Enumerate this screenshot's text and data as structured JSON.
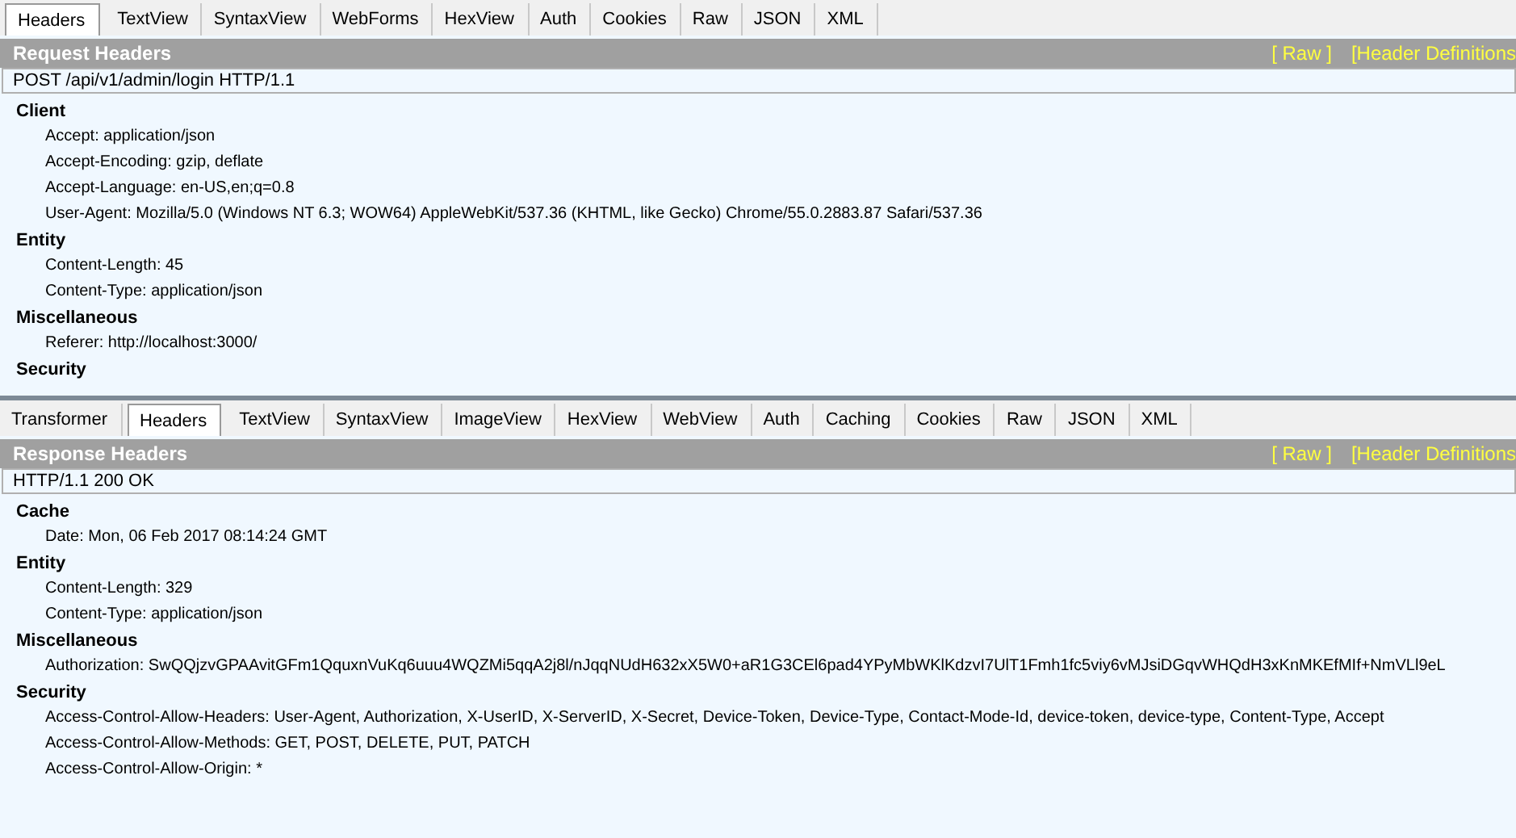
{
  "request": {
    "tabs": [
      {
        "label": "Headers",
        "selected": true
      },
      {
        "label": "TextView",
        "selected": false
      },
      {
        "label": "SyntaxView",
        "selected": false
      },
      {
        "label": "WebForms",
        "selected": false
      },
      {
        "label": "HexView",
        "selected": false
      },
      {
        "label": "Auth",
        "selected": false
      },
      {
        "label": "Cookies",
        "selected": false
      },
      {
        "label": "Raw",
        "selected": false
      },
      {
        "label": "JSON",
        "selected": false
      },
      {
        "label": "XML",
        "selected": false
      }
    ],
    "title": "Request Headers",
    "links": [
      "[ Raw ]",
      "[Header Definitions"
    ],
    "first_line": "POST /api/v1/admin/login HTTP/1.1",
    "groups": [
      {
        "name": "Client",
        "headers": [
          "Accept: application/json",
          "Accept-Encoding: gzip, deflate",
          "Accept-Language: en-US,en;q=0.8",
          "User-Agent: Mozilla/5.0 (Windows NT 6.3; WOW64) AppleWebKit/537.36 (KHTML, like Gecko) Chrome/55.0.2883.87 Safari/537.36"
        ]
      },
      {
        "name": "Entity",
        "headers": [
          "Content-Length: 45",
          "Content-Type: application/json"
        ]
      },
      {
        "name": "Miscellaneous",
        "headers": [
          "Referer: http://localhost:3000/"
        ]
      },
      {
        "name": "Security"
      }
    ]
  },
  "response": {
    "tabs": [
      {
        "label": "Transformer",
        "selected": false
      },
      {
        "label": "Headers",
        "selected": true
      },
      {
        "label": "TextView",
        "selected": false
      },
      {
        "label": "SyntaxView",
        "selected": false
      },
      {
        "label": "ImageView",
        "selected": false
      },
      {
        "label": "HexView",
        "selected": false
      },
      {
        "label": "WebView",
        "selected": false
      },
      {
        "label": "Auth",
        "selected": false
      },
      {
        "label": "Caching",
        "selected": false
      },
      {
        "label": "Cookies",
        "selected": false
      },
      {
        "label": "Raw",
        "selected": false
      },
      {
        "label": "JSON",
        "selected": false
      },
      {
        "label": "XML",
        "selected": false
      }
    ],
    "title": "Response Headers",
    "links": [
      "[ Raw ]",
      "[Header Definitions"
    ],
    "first_line": "HTTP/1.1 200 OK",
    "groups": [
      {
        "name": "Cache",
        "headers": [
          "Date: Mon, 06 Feb 2017 08:14:24 GMT"
        ]
      },
      {
        "name": "Entity",
        "headers": [
          "Content-Length: 329",
          "Content-Type: application/json"
        ]
      },
      {
        "name": "Miscellaneous",
        "headers": [
          "Authorization: SwQQjzvGPAAvitGFm1QquxnVuKq6uuu4WQZMi5qqA2j8l/nJqqNUdH632xX5W0+aR1G3CEl6pad4YPyMbWKlKdzvI7UlT1Fmh1fc5viy6vMJsiDGqvWHQdH3xKnMKEfMIf+NmVLl9eL"
        ]
      },
      {
        "name": "Security",
        "headers": [
          "Access-Control-Allow-Headers: User-Agent, Authorization, X-UserID, X-ServerID, X-Secret, Device-Token, Device-Type, Contact-Mode-Id, device-token, device-type, Content-Type, Accept",
          "Access-Control-Allow-Methods: GET, POST, DELETE, PUT, PATCH",
          "Access-Control-Allow-Origin: *"
        ]
      }
    ]
  }
}
